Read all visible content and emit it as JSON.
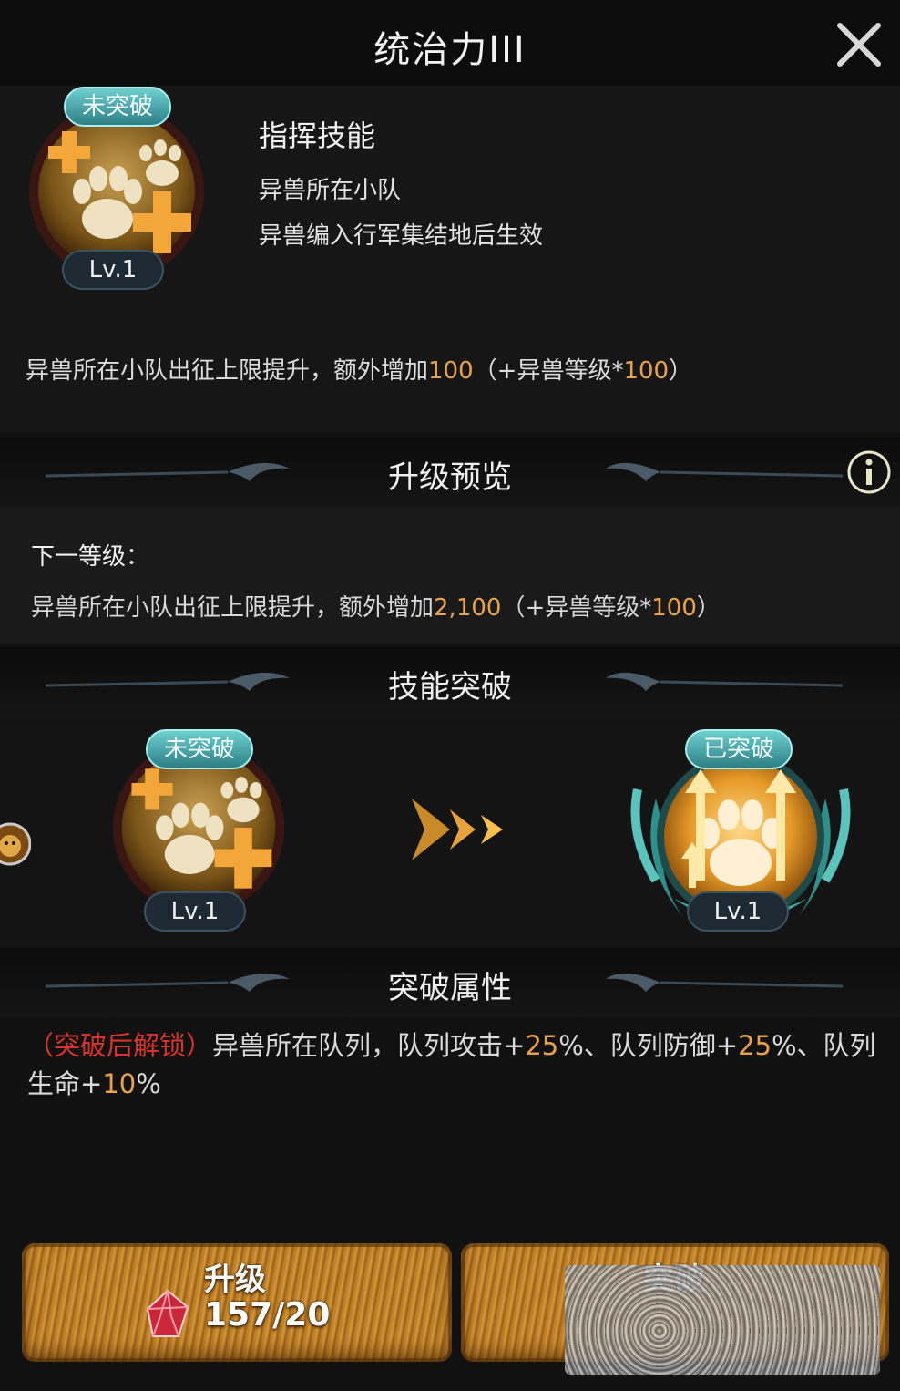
{
  "title": "统治力III",
  "icons": {
    "close": "close-icon",
    "info": "info-icon",
    "paw": "paw-icon",
    "arrows": "triple-chevron-right-icon",
    "gem": "red-crystal-icon",
    "lion": "lion-avatar"
  },
  "skill": {
    "status_badge": "未突破",
    "level": "Lv.1",
    "type": "指挥技能",
    "scope": "异兽所在小队",
    "condition": "异兽编入行军集结地后生效",
    "desc_prefix": "异兽所在小队出征上限提升，额外增加",
    "desc_value": "100",
    "desc_mid": "（+异兽等级*",
    "desc_factor": "100",
    "desc_suffix": "）"
  },
  "preview": {
    "header": "升级预览",
    "next_label": "下一等级：",
    "desc_prefix": "异兽所在小队出征上限提升，额外增加",
    "desc_value": "2,100",
    "desc_mid": "（+异兽等级*",
    "desc_factor": "100",
    "desc_suffix": "）"
  },
  "breakthrough": {
    "header": "技能突破",
    "before_badge": "未突破",
    "before_level": "Lv.1",
    "after_badge": "已突破",
    "after_level": "Lv.1"
  },
  "attributes": {
    "header": "突破属性",
    "locked_label": "（突破后解锁）",
    "text_1": "异兽所在队列，队列攻击+",
    "attack": "25",
    "text_2": "%、队列防御+",
    "defense": "25",
    "text_3": "%、队列生命+",
    "health": "10",
    "text_4": "%"
  },
  "buttons": {
    "upgrade_label": "升级",
    "upgrade_cost": "157/20",
    "break_label": "突破"
  },
  "colors": {
    "highlight": "#e9a24a",
    "locked": "#d9342b",
    "badge_teal": "#4fb3b6",
    "gold": "#d79a3a"
  }
}
